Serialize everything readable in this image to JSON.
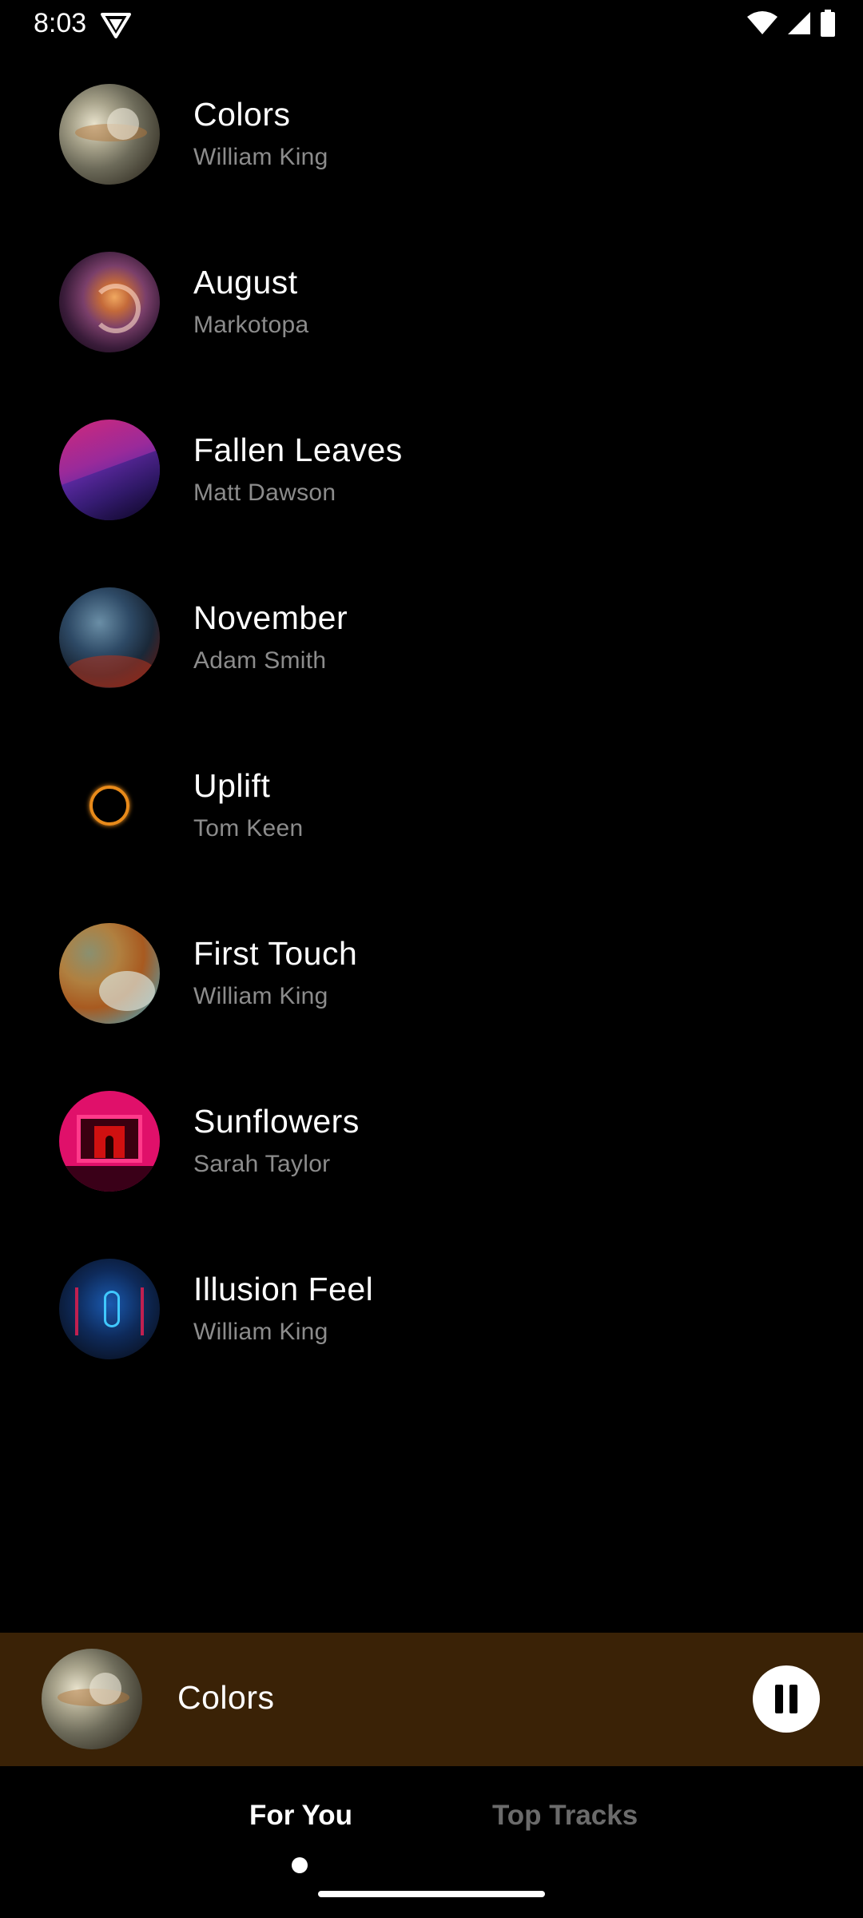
{
  "status_bar": {
    "time": "8:03",
    "icons": [
      "vpn-shield-icon",
      "wifi-icon",
      "cellular-signal-icon",
      "battery-icon"
    ]
  },
  "tracks": [
    {
      "title": "Colors",
      "artist": "William King",
      "art": "abstract-gray-gold"
    },
    {
      "title": "August",
      "artist": "Markotopa",
      "art": "swirl-purple-orange"
    },
    {
      "title": "Fallen Leaves",
      "artist": "Matt Dawson",
      "art": "magenta-purple-sky"
    },
    {
      "title": "November",
      "artist": "Adam Smith",
      "art": "blue-red-smoke"
    },
    {
      "title": "Uplift",
      "artist": "Tom Keen",
      "art": "orange-ring"
    },
    {
      "title": "First Touch",
      "artist": "William King",
      "art": "cloud-orange-teal"
    },
    {
      "title": "Sunflowers",
      "artist": "Sarah Taylor",
      "art": "neon-pink-frame"
    },
    {
      "title": "Illusion Feel",
      "artist": "William King",
      "art": "blue-neon-stage"
    }
  ],
  "mini_player": {
    "title": "Colors",
    "control_icon": "pause-icon",
    "background": "#3a2206"
  },
  "tabs": [
    {
      "label": "For You",
      "selected": true
    },
    {
      "label": "Top Tracks",
      "selected": false
    }
  ],
  "colors": {
    "background": "#000000",
    "text_primary": "#ffffff",
    "text_secondary": "#8c8c8c",
    "tab_inactive": "#6b6b6b"
  }
}
